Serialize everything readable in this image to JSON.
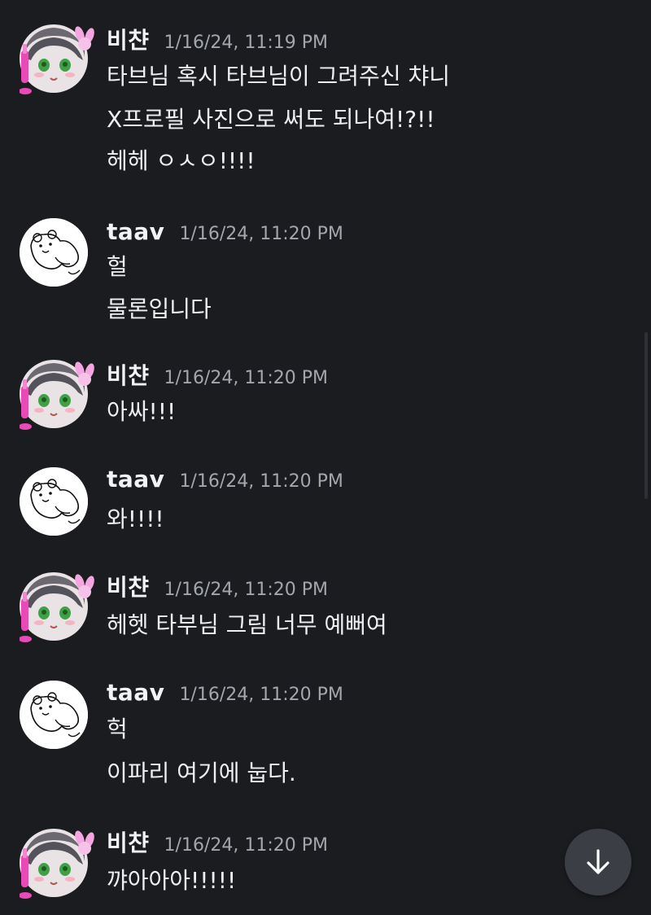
{
  "messages": [
    {
      "user": "비챤",
      "time": "1/16/24, 11:19 PM",
      "lines": [
        "타브님 혹시 타브님이 그려주신 챠니",
        "X프로필 사진으로 써도 되나여!?!!",
        "헤헤 ㅇㅅㅇ!!!!"
      ]
    },
    {
      "user": "taav",
      "time": "1/16/24, 11:20 PM",
      "lines": [
        "헐",
        "물론입니다"
      ]
    },
    {
      "user": "비챤",
      "time": "1/16/24, 11:20 PM",
      "lines": [
        "아싸!!!"
      ]
    },
    {
      "user": "taav",
      "time": "1/16/24, 11:20 PM",
      "lines": [
        "와!!!!"
      ]
    },
    {
      "user": "비챤",
      "time": "1/16/24, 11:20 PM",
      "lines": [
        "헤헷 타부님 그림 너무 예뻐여"
      ]
    },
    {
      "user": "taav",
      "time": "1/16/24, 11:20 PM",
      "lines": [
        "헉",
        "이파리 여기에 눕다."
      ]
    },
    {
      "user": "비챤",
      "time": "1/16/24, 11:20 PM",
      "lines": [
        "꺄아아아!!!!!"
      ]
    }
  ],
  "icons": {
    "jump_to_bottom": "arrow-down-icon",
    "avatar_bichan": "anime-girl-bunny-avatar",
    "avatar_taav": "bear-sketch-avatar"
  },
  "colors": {
    "background": "#1b1c20",
    "text": "#eeeff1",
    "timestamp": "#a3a6ad",
    "button": "#3c3e45"
  }
}
